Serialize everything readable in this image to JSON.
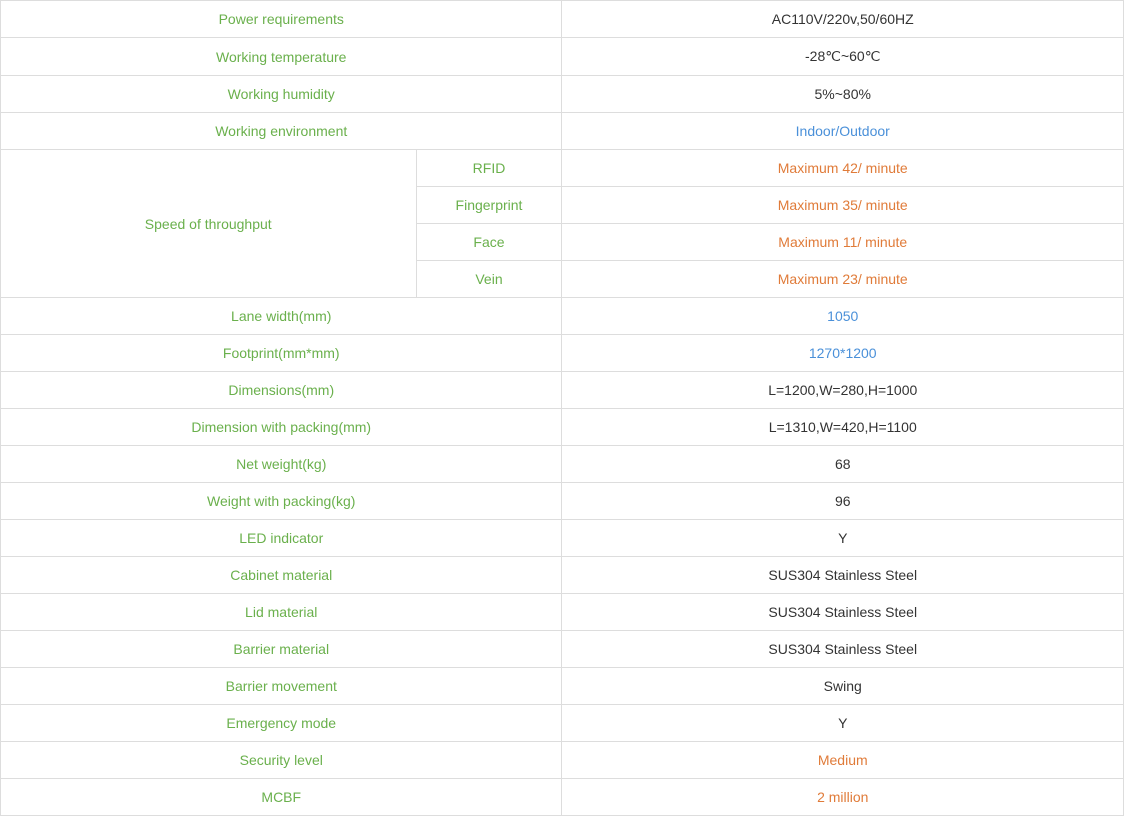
{
  "rows": [
    {
      "label": "Power requirements",
      "value": "AC110V/220v,50/60HZ",
      "labelClass": "label-green",
      "valueClass": "value-dark",
      "type": "simple"
    },
    {
      "label": "Working temperature",
      "value": "-28℃~60℃",
      "labelClass": "label-green",
      "valueClass": "value-dark",
      "type": "simple"
    },
    {
      "label": "Working humidity",
      "value": "5%~80%",
      "labelClass": "label-green",
      "valueClass": "value-dark",
      "type": "simple"
    },
    {
      "label": "Working environment",
      "value": "Indoor/Outdoor",
      "labelClass": "label-green",
      "valueClass": "value-blue",
      "type": "simple"
    },
    {
      "label": "Speed of throughput",
      "labelClass": "label-green",
      "type": "group",
      "subrows": [
        {
          "sublabel": "RFID",
          "value": "Maximum 42/ minute",
          "sublabelClass": "label-green",
          "valueClass": "value-orange"
        },
        {
          "sublabel": "Fingerprint",
          "value": "Maximum 35/ minute",
          "sublabelClass": "label-green",
          "valueClass": "value-orange"
        },
        {
          "sublabel": "Face",
          "value": "Maximum 11/ minute",
          "sublabelClass": "label-green",
          "valueClass": "value-orange"
        },
        {
          "sublabel": "Vein",
          "value": "Maximum 23/ minute",
          "sublabelClass": "label-green",
          "valueClass": "value-orange"
        }
      ]
    },
    {
      "label": "Lane width(mm)",
      "value": "1050",
      "labelClass": "label-green",
      "valueClass": "value-blue",
      "type": "simple"
    },
    {
      "label": "Footprint(mm*mm)",
      "value": "1270*1200",
      "labelClass": "label-green",
      "valueClass": "value-blue",
      "type": "simple"
    },
    {
      "label": "Dimensions(mm)",
      "value": "L=1200,W=280,H=1000",
      "labelClass": "label-green",
      "valueClass": "value-dark",
      "type": "simple"
    },
    {
      "label": "Dimension with packing(mm)",
      "value": "L=1310,W=420,H=1100",
      "labelClass": "label-green",
      "valueClass": "value-dark",
      "type": "simple"
    },
    {
      "label": "Net weight(kg)",
      "value": "68",
      "labelClass": "label-green",
      "valueClass": "value-dark",
      "type": "simple"
    },
    {
      "label": "Weight with packing(kg)",
      "value": "96",
      "labelClass": "label-green",
      "valueClass": "value-dark",
      "type": "simple"
    },
    {
      "label": "LED indicator",
      "value": "Y",
      "labelClass": "label-green",
      "valueClass": "value-dark",
      "type": "simple"
    },
    {
      "label": "Cabinet material",
      "value": "SUS304 Stainless Steel",
      "labelClass": "label-green",
      "valueClass": "value-dark",
      "type": "simple"
    },
    {
      "label": "Lid material",
      "value": "SUS304 Stainless Steel",
      "labelClass": "label-green",
      "valueClass": "value-dark",
      "type": "simple"
    },
    {
      "label": "Barrier material",
      "value": "SUS304 Stainless Steel",
      "labelClass": "label-green",
      "valueClass": "value-dark",
      "type": "simple"
    },
    {
      "label": "Barrier movement",
      "value": "Swing",
      "labelClass": "label-green",
      "valueClass": "value-dark",
      "type": "simple"
    },
    {
      "label": "Emergency mode",
      "value": "Y",
      "labelClass": "label-green",
      "valueClass": "value-dark",
      "type": "simple"
    },
    {
      "label": "Security level",
      "value": "Medium",
      "labelClass": "label-green",
      "valueClass": "value-orange",
      "type": "simple"
    },
    {
      "label": "MCBF",
      "value": "2 million",
      "labelClass": "label-green",
      "valueClass": "value-orange",
      "type": "simple"
    }
  ]
}
